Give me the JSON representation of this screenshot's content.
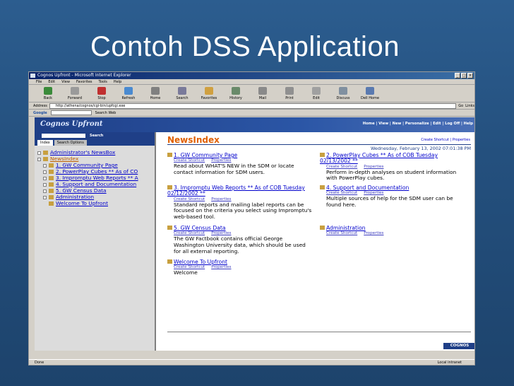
{
  "slide": {
    "title": "Contoh DSS Application"
  },
  "window": {
    "title": "Cognos Upfront - Microsoft Internet Explorer",
    "menu": [
      "File",
      "Edit",
      "View",
      "Favorites",
      "Tools",
      "Help"
    ],
    "toolbar": [
      "Back",
      "Forward",
      "Stop",
      "Refresh",
      "Home",
      "Search",
      "Favorites",
      "History",
      "Mail",
      "Print",
      "Edit",
      "Discuss",
      "Dell Home"
    ],
    "address_label": "Address",
    "address_value": "http://athena/cognos/cgi-bin/upfcgi.exe",
    "go_label": "Go",
    "links_label": "Links",
    "google_label": "Google",
    "search_web_label": "Search Web",
    "status_left": "Done",
    "status_right": "Local intranet"
  },
  "app": {
    "logo": "Cognos Upfront",
    "nav": "Home | View | New | Personalize | Edit | Log Off | Help",
    "search_button": "Search",
    "tabs": [
      "Index",
      "Search Options"
    ],
    "tree": [
      {
        "label": "Administrator's NewsBox",
        "style": "link"
      },
      {
        "label": "NewsIndex",
        "style": "highlight"
      },
      {
        "label": "1. GW Community Page",
        "style": "link"
      },
      {
        "label": "2. PowerPlay Cubes ** As of CO",
        "style": "link"
      },
      {
        "label": "3. Impromptu Web Reports ** A",
        "style": "link"
      },
      {
        "label": "4. Support and Documentation",
        "style": "link"
      },
      {
        "label": "5. GW Census Data",
        "style": "link"
      },
      {
        "label": "Administration",
        "style": "link"
      },
      {
        "label": "Welcome To Upfront",
        "style": "link"
      }
    ],
    "newsindex": {
      "title": "NewsIndex",
      "top_links": "Create Shortcut | Properties",
      "date": "Wednesday, February 13, 2002 07:01:38 PM",
      "link_shortcut": "Create Shortcut",
      "link_properties": "Properties",
      "entries_left": [
        {
          "title": "1. GW Community Page",
          "desc": "Read about WHAT'S NEW in the SDM or locate contact information for SDM users."
        },
        {
          "title": "3. Impromptu Web Reports ** As of COB Tuesday 02/12/2002 **",
          "desc": "Standard reports and mailing label reports can be focused on the criteria you select using Impromptu's web-based tool."
        },
        {
          "title": "5. GW Census Data",
          "desc": "The GW Factbook contains official George Washington University data, which should be used for all external reporting."
        },
        {
          "title": "Welcome To Upfront",
          "desc": "Welcome"
        }
      ],
      "entries_right": [
        {
          "title": "2. PowerPlay Cubes ** As of COB Tuesday 02/13/2002 **",
          "desc": "Perform in-depth analyses on student information with PowerPlay cubes."
        },
        {
          "title": "4. Support and Documentation",
          "desc": "Multiple sources of help for the SDM user can be found here."
        },
        {
          "title": "Administration",
          "desc": ""
        }
      ],
      "footer_logo": "COGNOS"
    }
  }
}
